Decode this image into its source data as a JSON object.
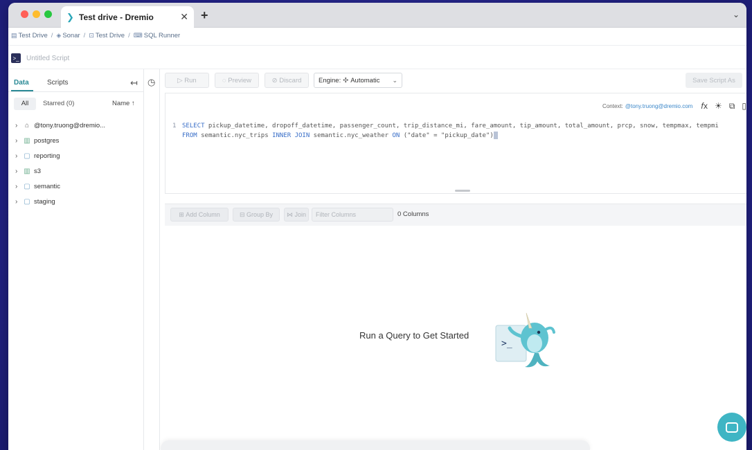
{
  "browser": {
    "tab_title": "Test drive - Dremio",
    "close_glyph": "✕",
    "new_tab_glyph": "+",
    "menu_glyph": "⌄"
  },
  "breadcrumb": [
    "Test Drive",
    "Sonar",
    "Test Drive",
    "SQL Runner"
  ],
  "script": {
    "name": "Untitled Script"
  },
  "sidebar": {
    "tabs": [
      "Data",
      "Scripts"
    ],
    "filters": {
      "all": "All",
      "starred": "Starred (0)",
      "sort": "Name ↑"
    },
    "items": [
      {
        "label": "@tony.truong@dremio...",
        "icon": "home-icon"
      },
      {
        "label": "postgres",
        "icon": "database-icon"
      },
      {
        "label": "reporting",
        "icon": "space-icon"
      },
      {
        "label": "s3",
        "icon": "database-icon"
      },
      {
        "label": "semantic",
        "icon": "space-icon"
      },
      {
        "label": "staging",
        "icon": "space-icon"
      }
    ]
  },
  "toolbar": {
    "run": "Run",
    "preview": "Preview",
    "discard": "Discard",
    "engine_label": "Engine:",
    "engine_value": "Automatic",
    "save": "Save Script As"
  },
  "editor": {
    "context_label": "Context:",
    "context_value": "@tony.truong@dremio.com",
    "line_number": "1",
    "line1_kw1": "SELECT",
    "line1_rest": " pickup_datetime, dropoff_datetime, passenger_count, trip_distance_mi, fare_amount, tip_amount, total_amount, prcp, snow, tempmax, tempmi",
    "line2_kw1": "FROM",
    "line2_a": " semantic.nyc_trips ",
    "line2_kw2": "INNER JOIN",
    "line2_b": " semantic.nyc_weather ",
    "line2_kw3": "ON",
    "line2_c": " (\"date\" = \"pickup_date\")"
  },
  "results": {
    "add_column": "Add Column",
    "group_by": "Group By",
    "join": "Join",
    "filter_placeholder": "Filter Columns",
    "count": "0 Columns"
  },
  "empty_state": {
    "message": "Run a Query to Get Started"
  },
  "colors": {
    "accent": "#2a8a96",
    "chat": "#3fb5c4"
  }
}
